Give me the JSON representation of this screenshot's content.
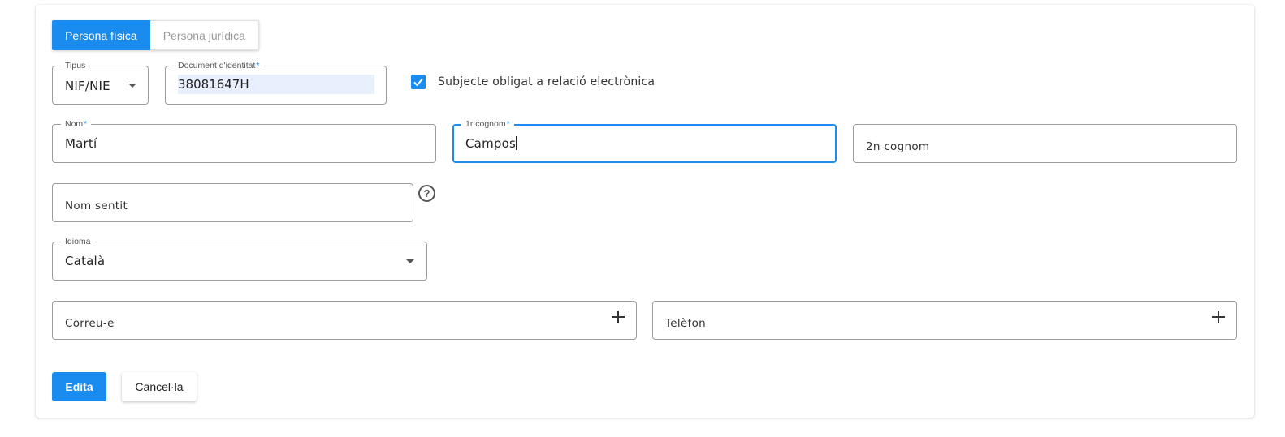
{
  "tabs": {
    "person_physical": "Persona física",
    "person_legal": "Persona jurídica"
  },
  "fields": {
    "tipus": {
      "label": "Tipus",
      "value": "NIF/NIE"
    },
    "document": {
      "label": "Document d'identitat",
      "required": "*",
      "value": "38081647H"
    },
    "nom": {
      "label": "Nom",
      "required": "*",
      "value": "Martí"
    },
    "cognom1": {
      "label": "1r cognom",
      "required": "*",
      "value": "Campos"
    },
    "cognom2": {
      "placeholder": "2n cognom"
    },
    "nom_sentit": {
      "placeholder": "Nom sentit"
    },
    "idioma": {
      "label": "Idioma",
      "value": "Català"
    },
    "correu": {
      "placeholder": "Correu-e"
    },
    "telefon": {
      "placeholder": "Telèfon"
    }
  },
  "checkbox": {
    "label": "Subjecte obligat a relació electrònica",
    "checked": true
  },
  "help_icon": "?",
  "buttons": {
    "edit": "Edita",
    "cancel": "Cancel·la"
  },
  "colors": {
    "accent": "#1a8cf0"
  }
}
